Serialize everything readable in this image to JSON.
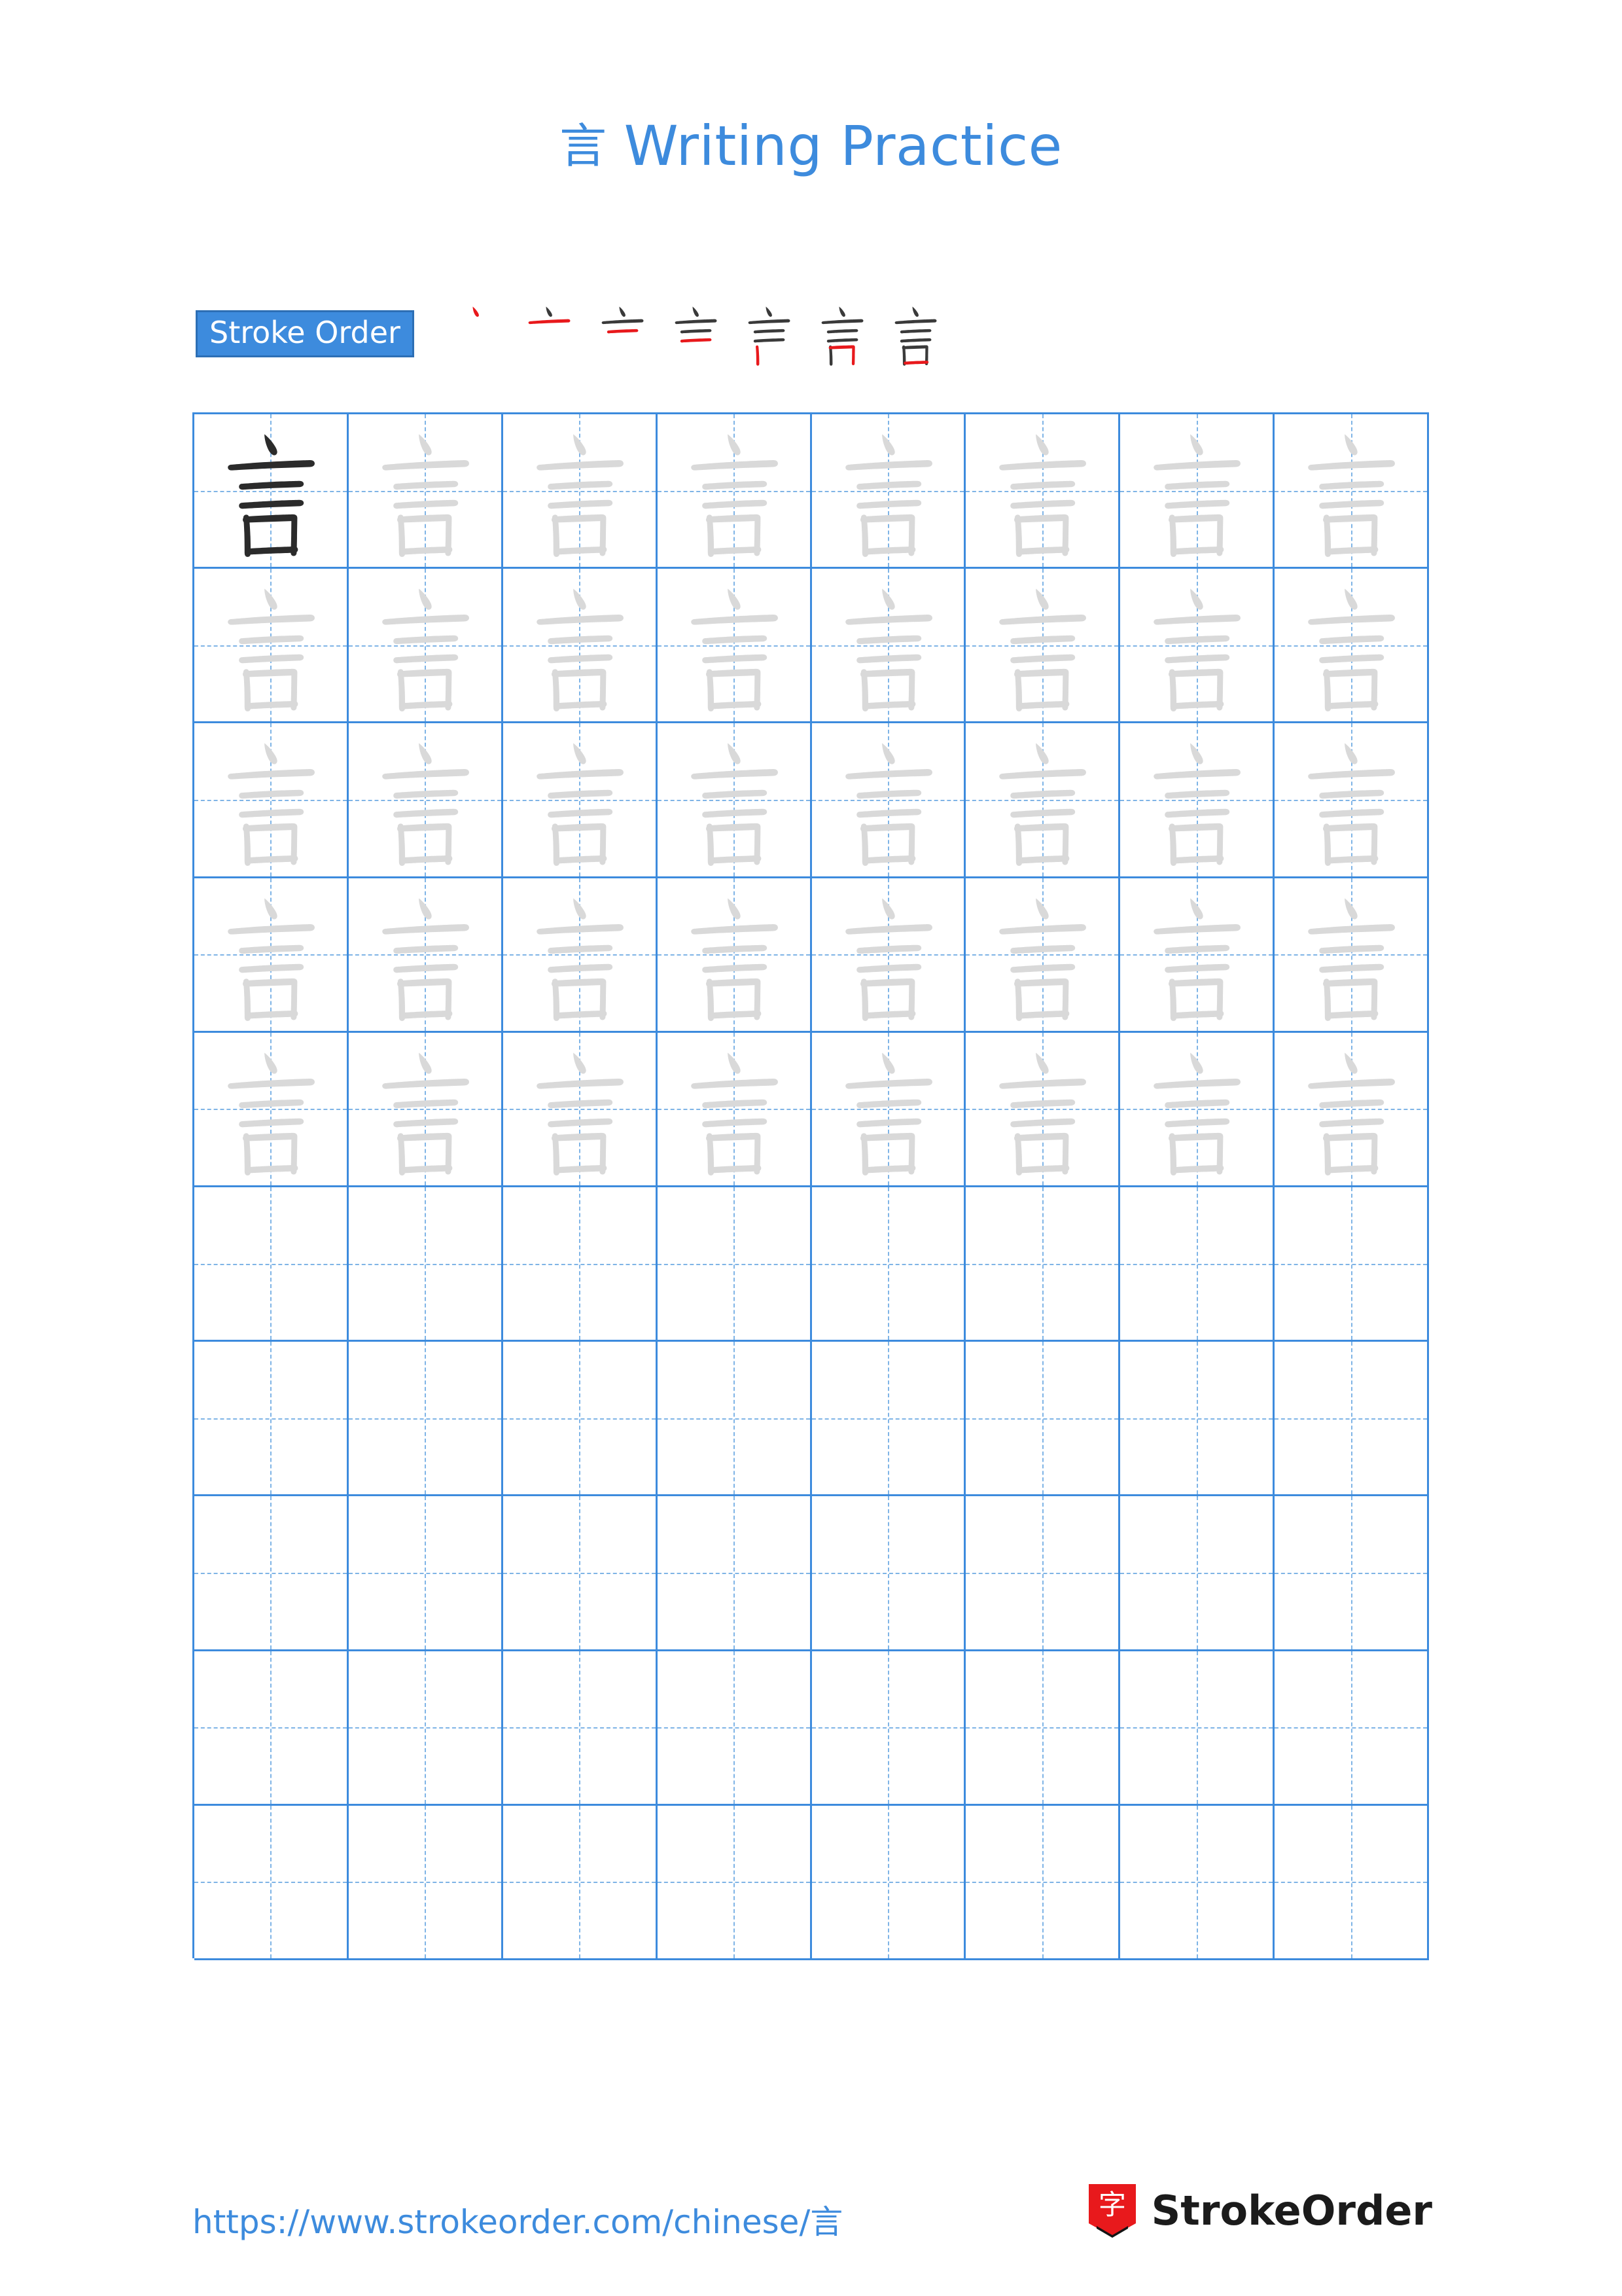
{
  "page": {
    "title_character": "言",
    "title_text": "Writing Practice",
    "title_color": "#3d8bdd"
  },
  "stroke_order": {
    "label": "Stroke Order",
    "label_bg": "#3d8bdd",
    "label_color": "#ffffff",
    "highlight_color": "#e8191c",
    "ink_color": "#3a3a3a",
    "steps": [
      {
        "index": 1,
        "strokes_shown": 1,
        "new_stroke": 1
      },
      {
        "index": 2,
        "strokes_shown": 2,
        "new_stroke": 2
      },
      {
        "index": 3,
        "strokes_shown": 3,
        "new_stroke": 3
      },
      {
        "index": 4,
        "strokes_shown": 4,
        "new_stroke": 4
      },
      {
        "index": 5,
        "strokes_shown": 5,
        "new_stroke": 5
      },
      {
        "index": 6,
        "strokes_shown": 6,
        "new_stroke": 6
      },
      {
        "index": 7,
        "strokes_shown": 7,
        "new_stroke": 7
      }
    ],
    "total_strokes": 7
  },
  "practice_grid": {
    "columns": 8,
    "rows": 10,
    "grid_line_color": "#3d8bdd",
    "guide_line_color": "#7fb4e6",
    "filled_rows": 5,
    "dark_cells": [
      {
        "row": 0,
        "col": 0
      }
    ],
    "traced_character": "言",
    "dark_ink": "#2b2b2b",
    "light_ink": "#d9d9d9"
  },
  "footer": {
    "url": "https://www.strokeorder.com/chinese/言",
    "url_color": "#3d8bdd",
    "brand_name": "StrokeOrder",
    "brand_logo_character": "字",
    "brand_logo_color": "#e8191c"
  }
}
